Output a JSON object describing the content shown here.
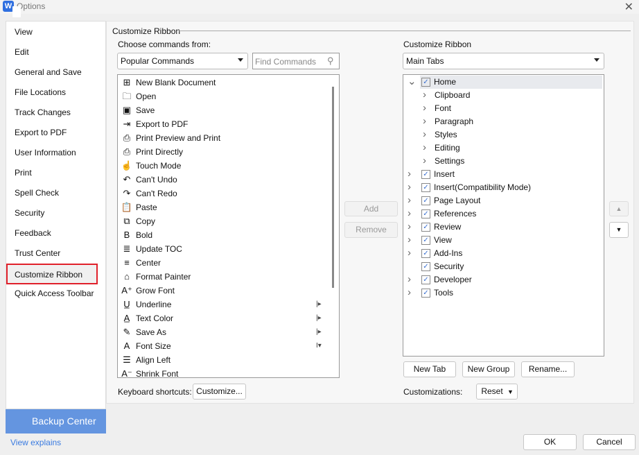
{
  "window": {
    "title": "Options",
    "app_icon": "W"
  },
  "sidebar": {
    "items": [
      "View",
      "Edit",
      "General and Save",
      "File Locations",
      "Track Changes",
      "Export to PDF",
      "User Information",
      "Print",
      "Spell Check",
      "Security",
      "Feedback",
      "Trust Center",
      "Customize Ribbon",
      "Quick Access Toolbar"
    ],
    "selected": "Customize Ribbon",
    "backup_label": "Backup Center",
    "view_explains": "View explains"
  },
  "main": {
    "section_title": "Customize Ribbon",
    "left": {
      "label": "Choose commands from:",
      "dropdown": "Popular Commands",
      "search_placeholder": "Find Commands",
      "commands": [
        {
          "label": "New Blank Document",
          "icon": "⊞"
        },
        {
          "label": "Open",
          "icon": "🗀"
        },
        {
          "label": "Save",
          "icon": "▣"
        },
        {
          "label": "Export to PDF",
          "icon": "⇥"
        },
        {
          "label": "Print Preview and Print",
          "icon": "⎙"
        },
        {
          "label": "Print  Directly",
          "icon": "⎙"
        },
        {
          "label": "Touch Mode",
          "icon": "☝"
        },
        {
          "label": "Can't Undo",
          "icon": "↶"
        },
        {
          "label": "Can't Redo",
          "icon": "↷"
        },
        {
          "label": "Paste",
          "icon": "📋"
        },
        {
          "label": "Copy",
          "icon": "⧉"
        },
        {
          "label": "Bold",
          "icon": "B"
        },
        {
          "label": "Update  TOC",
          "icon": "≣"
        },
        {
          "label": "Center",
          "icon": "≡"
        },
        {
          "label": "Format  Painter",
          "icon": "⌂"
        },
        {
          "label": "Grow Font",
          "icon": "A⁺"
        },
        {
          "label": "Underline",
          "icon": "U̲",
          "sub": "|▸"
        },
        {
          "label": "Text Color",
          "icon": "A̲",
          "sub": "|▸"
        },
        {
          "label": "Save As",
          "icon": "✎",
          "sub": "|▸"
        },
        {
          "label": "Font Size",
          "icon": "A",
          "sub": "I▾"
        },
        {
          "label": "Align Left",
          "icon": "☰"
        },
        {
          "label": "Shrink Font",
          "icon": "A⁻"
        }
      ],
      "keyboard_label": "Keyboard shortcuts:",
      "customize_button": "Customize..."
    },
    "add_button": "Add",
    "remove_button": "Remove",
    "right": {
      "label": "Customize Ribbon",
      "dropdown": "Main Tabs",
      "tree": [
        {
          "label": "Home",
          "level": 0,
          "checked": true,
          "expanded": true,
          "selected": true
        },
        {
          "label": "Clipboard",
          "level": 1
        },
        {
          "label": "Font",
          "level": 1
        },
        {
          "label": "Paragraph",
          "level": 1
        },
        {
          "label": "Styles",
          "level": 1
        },
        {
          "label": "Editing",
          "level": 1
        },
        {
          "label": "Settings",
          "level": 1
        },
        {
          "label": "Insert",
          "level": 0,
          "checked": true
        },
        {
          "label": "Insert(Compatibility Mode)",
          "level": 0,
          "checked": true
        },
        {
          "label": "Page Layout",
          "level": 0,
          "checked": true
        },
        {
          "label": "References",
          "level": 0,
          "checked": true
        },
        {
          "label": "Review",
          "level": 0,
          "checked": true
        },
        {
          "label": "View",
          "level": 0,
          "checked": true
        },
        {
          "label": "Add-Ins",
          "level": 0,
          "checked": true
        },
        {
          "label": "Security",
          "level": 0,
          "checked": true,
          "leaf": true
        },
        {
          "label": "Developer",
          "level": 0,
          "checked": true
        },
        {
          "label": "Tools",
          "level": 0,
          "checked": true
        }
      ],
      "new_tab": "New Tab",
      "new_group": "New Group",
      "rename": "Rename...",
      "customizations_label": "Customizations:",
      "reset": "Reset"
    }
  },
  "footer": {
    "ok": "OK",
    "cancel": "Cancel"
  }
}
